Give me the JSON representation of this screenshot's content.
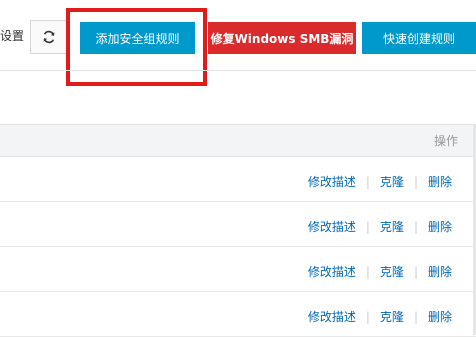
{
  "toolbar": {
    "settings_label": "设置",
    "refresh_icon": "refresh-icon",
    "add_rule_label": "添加安全组规则",
    "fix_smb_label": "修复Windows SMB漏洞",
    "quick_create_label": "快速创建规则"
  },
  "table": {
    "action_header": "操作",
    "rows": [
      {
        "edit": "修改描述",
        "clone": "克隆",
        "delete": "删除"
      },
      {
        "edit": "修改描述",
        "clone": "克隆",
        "delete": "删除"
      },
      {
        "edit": "修改描述",
        "clone": "克隆",
        "delete": "删除"
      },
      {
        "edit": "修改描述",
        "clone": "克隆",
        "delete": "删除"
      }
    ]
  },
  "colors": {
    "primary_button": "#0099cc",
    "danger_button": "#d92b2b",
    "highlight_border": "#e11a1a",
    "link": "#0068b7"
  }
}
